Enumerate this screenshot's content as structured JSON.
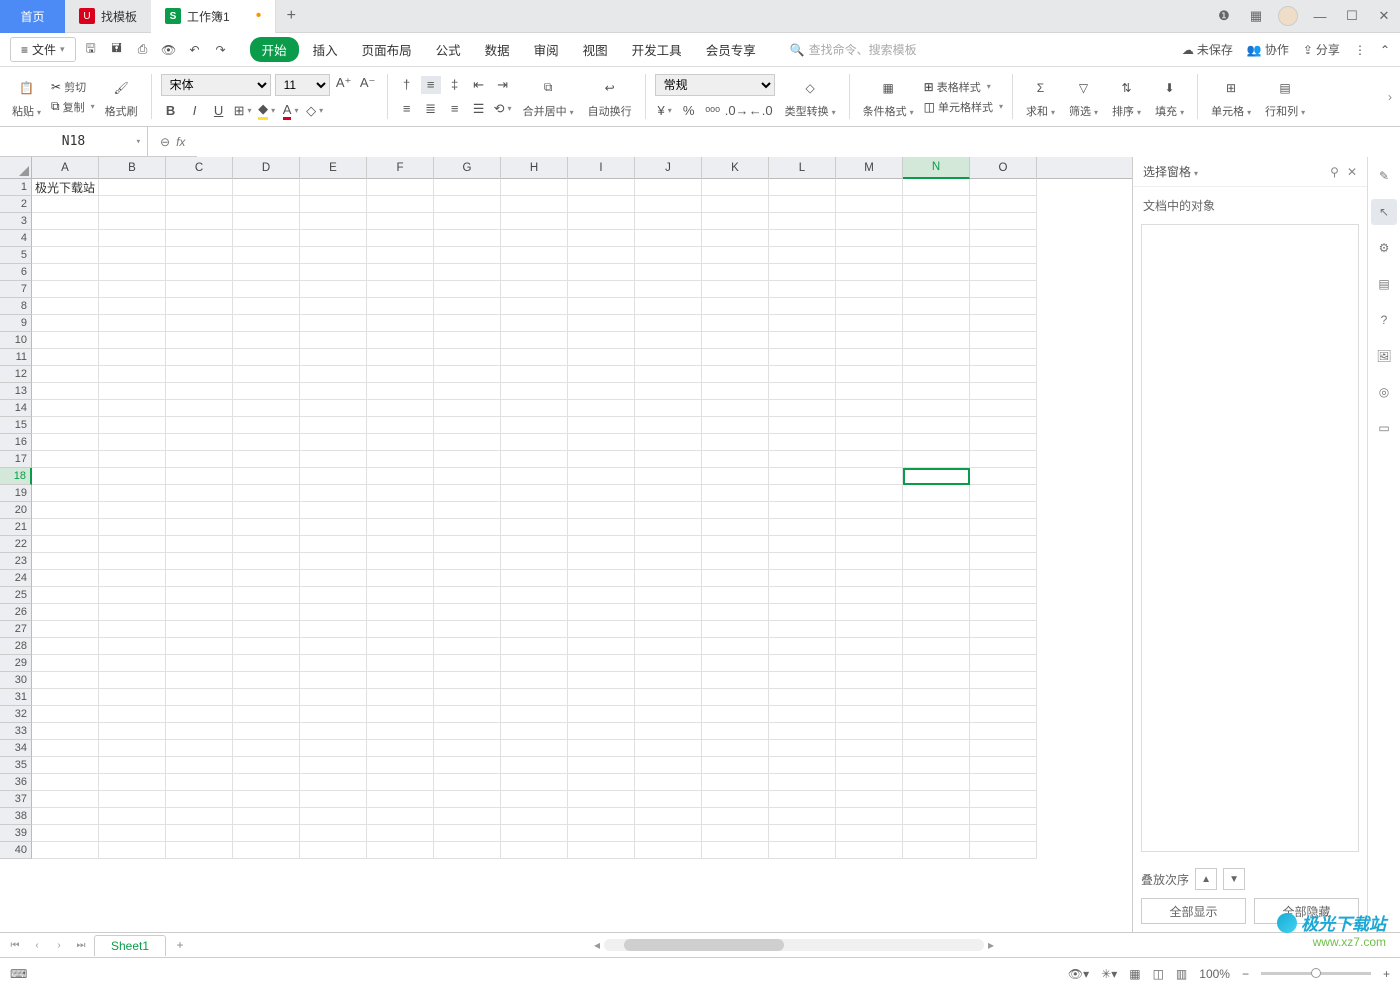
{
  "titlebar": {
    "home": "首页",
    "template": "找模板",
    "doc": "工作簿1",
    "addTab": "+"
  },
  "menubar": {
    "file": "文件",
    "menus": [
      "开始",
      "插入",
      "页面布局",
      "公式",
      "数据",
      "审阅",
      "视图",
      "开发工具",
      "会员专享"
    ],
    "activeIndex": 0,
    "searchPlaceholder": "查找命令、搜索模板",
    "unsaved": "未保存",
    "collab": "协作",
    "share": "分享"
  },
  "ribbon": {
    "paste": "粘贴",
    "cut": "剪切",
    "copy": "复制",
    "formatPainter": "格式刷",
    "fontName": "宋体",
    "fontSize": "11",
    "mergeCenter": "合并居中",
    "autoWrap": "自动换行",
    "numberFormat": "常规",
    "typeConvert": "类型转换",
    "condFormat": "条件格式",
    "tableFormat": "表格样式",
    "cellFormat": "单元格样式",
    "sum": "求和",
    "filter": "筛选",
    "sort": "排序",
    "fill": "填充",
    "cells": "单元格",
    "rowsCols": "行和列"
  },
  "fxbar": {
    "cellRef": "N18",
    "formula": ""
  },
  "grid": {
    "columns": [
      "A",
      "B",
      "C",
      "D",
      "E",
      "F",
      "G",
      "H",
      "I",
      "J",
      "K",
      "L",
      "M",
      "N",
      "O"
    ],
    "selectedColIndex": 13,
    "rows": 40,
    "selectedRow": 18,
    "cellA1": "极光下载站"
  },
  "panel": {
    "title": "选择窗格",
    "subtitle": "文档中的对象",
    "stackOrder": "叠放次序",
    "showAll": "全部显示",
    "hideAll": "全部隐藏"
  },
  "sheetbar": {
    "sheet": "Sheet1"
  },
  "statusbar": {
    "zoom": "100%"
  },
  "watermark": {
    "line1": "极光下载站",
    "line2": "www.xz7.com"
  }
}
